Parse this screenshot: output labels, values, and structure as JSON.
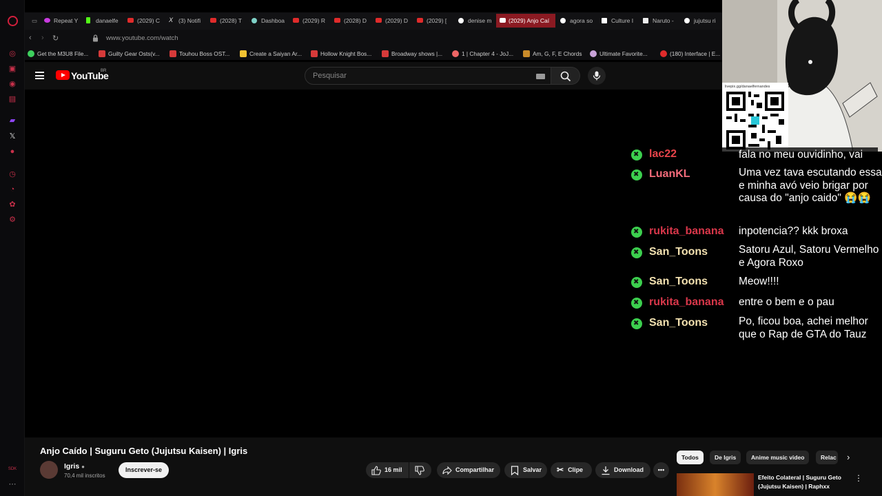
{
  "browser": {
    "tabs": [
      {
        "label": "Repeat Y",
        "icon": "opera-tab-icon"
      },
      {
        "label": "danaelfe",
        "icon": "kick-icon"
      },
      {
        "label": "(2029) C",
        "icon": "youtube-icon"
      },
      {
        "label": "(3) Notifi",
        "icon": "x-icon"
      },
      {
        "label": "(2028) T",
        "icon": "youtube-icon"
      },
      {
        "label": "Dashboa",
        "icon": "dashboard-icon"
      },
      {
        "label": "(2029) R",
        "icon": "youtube-icon"
      },
      {
        "label": "(2028) D",
        "icon": "youtube-icon"
      },
      {
        "label": "(2029) D",
        "icon": "youtube-icon"
      },
      {
        "label": "(2029) [",
        "icon": "youtube-icon"
      },
      {
        "label": "denise m",
        "icon": "google-icon"
      },
      {
        "label": "(2029) Anjo Caí",
        "icon": "youtube-icon"
      },
      {
        "label": "agora so",
        "icon": "google-icon"
      },
      {
        "label": "Culture I",
        "icon": "wiki-icon"
      },
      {
        "label": "Naruto -",
        "icon": "doc-icon"
      },
      {
        "label": "jujutsu ri",
        "icon": "google-icon"
      }
    ],
    "url": "www.youtube.com/watch",
    "bookmarks": [
      "Get the M3U8 File...",
      "Guilty Gear Osts(v...",
      "Touhou Boss OST...",
      "Create a Saiyan Ar...",
      "Hollow Knight Bos...",
      "Broadway shows |...",
      "1 | Chapter 4 - JoJ...",
      "Am, G, F, E Chords",
      "Ultimate Favorite...",
      "(180) Interface | E..."
    ]
  },
  "youtube": {
    "logo": "YouTube",
    "region": "BR",
    "search_placeholder": "Pesquisar"
  },
  "video": {
    "title": "Anjo Caído | Suguru Geto (Jujutsu Kaisen) | Igris",
    "channel": "Igris",
    "subscribers": "70,4 mil inscritos",
    "subscribe": "Inscrever-se",
    "likes": "16 mil",
    "share": "Compartilhar",
    "save": "Salvar",
    "clip": "Clipe",
    "download": "Download"
  },
  "chips": [
    "Todos",
    "De Igris",
    "Anime music video",
    "Relac"
  ],
  "recommended": {
    "title": "Efeito Colateral | Suguru Geto (Jujutsu Kaisen) | Raphxx"
  },
  "overlay": {
    "qr_caption": "livepix.gg/danaelfernandes"
  },
  "chat": [
    {
      "user": "lac22",
      "color": "#e8444a",
      "text": "fala no meu ouvidinho, vai"
    },
    {
      "user": "LuanKL",
      "color": "#f36b7a",
      "text": "Uma vez tava escutando essa e minha avó veio brigar por causa do \"anjo caido\" 😭😭"
    },
    {
      "user": "rukita_banana",
      "color": "#d9374a",
      "text": "inpotencia?? kkk broxa"
    },
    {
      "user": "San_Toons",
      "color": "#f3e1b0",
      "text": "Satoru Azul, Satoru Vermelho e Agora Roxo"
    },
    {
      "user": "San_Toons",
      "color": "#f3e1b0",
      "text": "Meow!!!!"
    },
    {
      "user": "rukita_banana",
      "color": "#d9374a",
      "text": "entre o bem e o pau"
    },
    {
      "user": "San_Toons",
      "color": "#f3e1b0",
      "text": "Po, ficou boa, achei melhor que o Rap de GTA do Tauz"
    }
  ],
  "sidebar_bottom": "SDK"
}
